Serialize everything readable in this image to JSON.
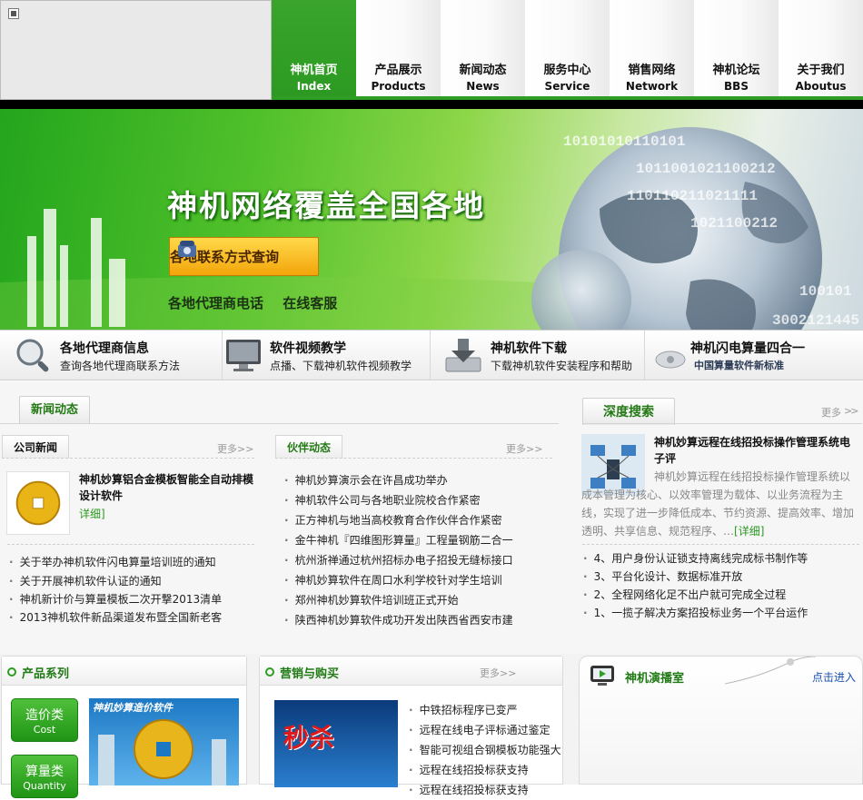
{
  "nav": {
    "items": [
      {
        "zh": "神机首页",
        "en": "Index",
        "active": true
      },
      {
        "zh": "产品展示",
        "en": "Products"
      },
      {
        "zh": "新闻动态",
        "en": "News"
      },
      {
        "zh": "服务中心",
        "en": "Service"
      },
      {
        "zh": "销售网络",
        "en": "Network"
      },
      {
        "zh": "神机论坛",
        "en": "BBS"
      },
      {
        "zh": "关于我们",
        "en": "Aboutus"
      }
    ]
  },
  "banner": {
    "headline": "神机网络覆盖全国各地",
    "button_label": "各地联系方式查询",
    "links": [
      "各地代理商电话",
      "在线客服"
    ],
    "binary_text": [
      "10101010110101",
      "1011001021100212",
      "110110211021111",
      "1021100212",
      "100101",
      "3002121445"
    ]
  },
  "features": [
    {
      "title": "各地代理商信息",
      "sub": "查询各地代理商联系方法",
      "icon": "magnifier-icon"
    },
    {
      "title": "软件视频教学",
      "sub": "点播、下载神机软件视频教学",
      "icon": "monitor-icon"
    },
    {
      "title": "神机软件下载",
      "sub": "下载神机软件安装程序和帮助",
      "icon": "download-icon"
    },
    {
      "title": "神机闪电算量四合一",
      "sub": "中国算量软件新标准",
      "icon": "disc-icon"
    }
  ],
  "news": {
    "title": "新闻动态",
    "company": {
      "tab": "公司新闻",
      "more": "更多>>",
      "feature_title": "神机妙算铝合金模板智能全自动排模设计软件",
      "feature_link": "详细]",
      "items": [
        "关于举办神机软件闪电算量培训班的通知",
        "关于开展神机软件认证的通知",
        "神机新计价与算量模板二次开撃2013清单",
        "2013神机软件新品渠道发布暨全国新老客"
      ]
    },
    "partner": {
      "tab": "伙伴动态",
      "more": "更多>>",
      "items": [
        "神机妙算演示会在许昌成功举办",
        "神机软件公司与各地职业院校合作紧密",
        "正方神机与地当高校教育合作伙伴合作紧密",
        "金牛神机『四维图形算量』工程量钢筋二合一",
        "杭州浙禅通过杭州招标办电子招投无缝标接口",
        "神机妙算软件在周口水利学校针对学生培训",
        "郑州神机妙算软件培训班正式开始",
        "陕西神机妙算软件成功开发出陕西省西安市建"
      ]
    }
  },
  "deep": {
    "title": "深度搜索",
    "more": "更多",
    "feature_title": "神机妙算远程在线招投标操作管理系统电子评",
    "desc": "神机妙算远程在线招投标操作管理系统以成本管理为核心、以效率管理为载体、以业务流程为主线，实现了进一步降低成本、节约资源、提高效率、增加透明、共享信息、规范程序、…",
    "detail": "[详细]",
    "items": [
      "4、用户身份认证锁支持离线完成标书制作等",
      "3、平台化设计、数据标准开放",
      "2、全程网络化足不出户就可完成全过程",
      "1、一揽子解决方案招投标业务一个平台运作"
    ]
  },
  "bottom": {
    "products": {
      "title": "产品系列",
      "cats": [
        {
          "zh": "造价类",
          "en": "Cost"
        },
        {
          "zh": "算量类",
          "en": "Quantity"
        }
      ],
      "banner_text": "神机妙算造价软件"
    },
    "marketing": {
      "title": "营销与购买",
      "more": "更多>>",
      "promo_text": "秒杀",
      "items": [
        "中铁招标程序已变严",
        "远程在线电子评标通过鉴定",
        "智能可视组合钢模板功能强大",
        "远程在线招投标获支持",
        "远程在线招投标获支持"
      ]
    },
    "studio": {
      "title": "神机演播室",
      "enter": "点击进入"
    }
  },
  "colors": {
    "brand_green": "#2f9e24",
    "link_green": "#2a9a1e",
    "button_orange": "#f3a50b"
  }
}
